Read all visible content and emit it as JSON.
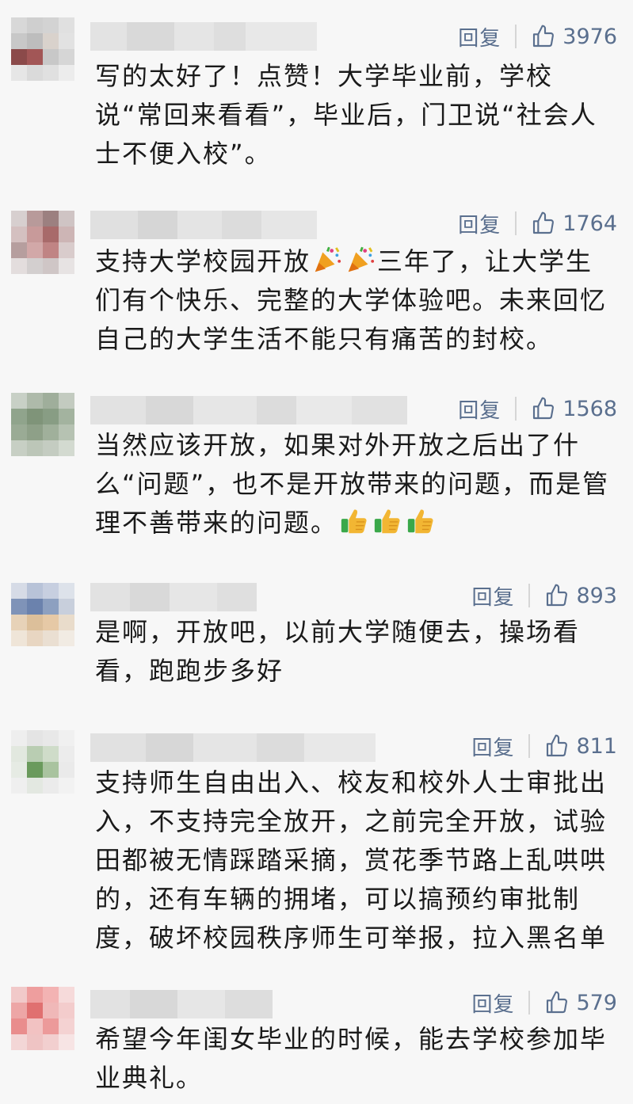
{
  "comments": [
    {
      "reply": "回复",
      "likes": "3976",
      "text": "写的太好了！点赞！大学毕业前，学校说“常回来看看”，毕业后，门卫说“社会人士不便入校”。",
      "avatar_colors": [
        "#d8d8d8",
        "#cfcfcf",
        "#d3d3d3",
        "#e0e0e0",
        "#c8c8c8",
        "#bdbdbd",
        "#d9d2cc",
        "#e2e2e2",
        "#8b4a4a",
        "#a25656",
        "#c8c8c8",
        "#d6d6d6",
        "#e6e6e6",
        "#dadada",
        "#e0e0e0",
        "#ececec"
      ]
    },
    {
      "reply": "回复",
      "likes": "1764",
      "text_parts": [
        "支持大学校园开放",
        "三年了，让大学生们有个快乐、完整的大学体验吧。未来回忆自己的大学生活不能只有痛苦的封校。"
      ],
      "avatar_colors": [
        "#d7cfcf",
        "#b89a9a",
        "#9c8080",
        "#cfc4c4",
        "#d4c0c0",
        "#c89a9a",
        "#a86a6a",
        "#cdb5b5",
        "#b69e9e",
        "#d2a8a8",
        "#c08484",
        "#d9cccc",
        "#e3dddd",
        "#d3cfcf",
        "#cfc6c6",
        "#e7e3e3"
      ]
    },
    {
      "reply": "回复",
      "likes": "1568",
      "text_parts": [
        "当然应该开放，如果对外开放之后出了什么“问题”，也不是开放带来的问题，而是管理不善带来的问题。",
        ""
      ],
      "avatar_colors": [
        "#c8d0c6",
        "#aebaaa",
        "#9fae9b",
        "#c3cbc0",
        "#90a48c",
        "#7f9479",
        "#889d84",
        "#a3b39f",
        "#9aab95",
        "#8ea088",
        "#a0b09b",
        "#b6c2b2",
        "#c7cfc4",
        "#bcc6b8",
        "#c4ccc1",
        "#d3dad0"
      ]
    },
    {
      "reply": "回复",
      "likes": "893",
      "text": "是啊，开放吧，以前大学随便去，操场看看，跑跑步多好",
      "avatar_colors": [
        "#d6dbe6",
        "#b8c3d8",
        "#c7cfe0",
        "#dde2ea",
        "#7f93b8",
        "#6b82ad",
        "#8da0c0",
        "#c8cfdc",
        "#e7d2b8",
        "#dcbf9a",
        "#e6c9a6",
        "#e9dccb",
        "#efe5d8",
        "#e8d6c2",
        "#eadfd2",
        "#f1ebe3"
      ]
    },
    {
      "reply": "回复",
      "likes": "811",
      "text": "支持师生自由出入、校友和校外人士审批出入，不支持完全放开，之前完全开放，试验田都被无情踩踏采摘，赏花季节路上乱哄哄的，还有车辆的拥堵，可以搞预约审批制度，破坏校园秩序师生可举报，拉入黑名单",
      "avatar_colors": [
        "#eeeeee",
        "#e4e4e4",
        "#e8e8e8",
        "#f0f0f0",
        "#e2e8df",
        "#b9cdb2",
        "#cfdcc9",
        "#ececec",
        "#e6ebe4",
        "#6a9a5c",
        "#a9c39f",
        "#eaeaea",
        "#efefef",
        "#e3e8e1",
        "#ebebeb",
        "#f2f2f2"
      ]
    },
    {
      "reply": "回复",
      "likes": "579",
      "text": "希望今年闺女毕业的时候，能去学校参加毕业典礼。",
      "avatar_colors": [
        "#f1c9c9",
        "#ee9e9e",
        "#f3b3b3",
        "#f6dada",
        "#eda6a6",
        "#e07070",
        "#f0b8b8",
        "#f3cccc",
        "#e98d8d",
        "#f2c2c2",
        "#ec9a9a",
        "#f4d2d2",
        "#f3d6d6",
        "#efc4c4",
        "#f2cfcf",
        "#f7e4e4"
      ]
    }
  ],
  "icons": {
    "like": "thumbs-up-outline-icon",
    "party": "party-popper-emoji",
    "thumbs": "thumbs-up-emoji"
  },
  "colors": {
    "action": "#5a6f8e",
    "text": "#1a1a1a",
    "background": "#f7f7f7"
  }
}
